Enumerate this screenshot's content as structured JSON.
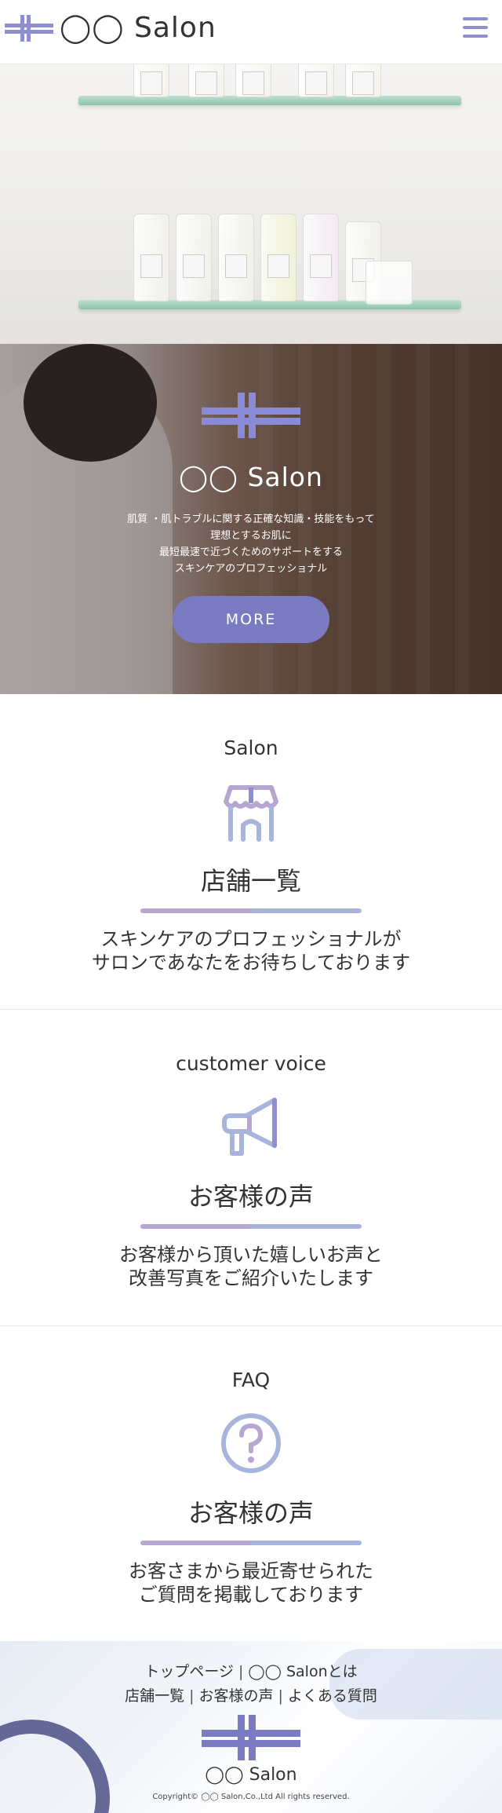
{
  "header": {
    "logo_text": "◯◯ Salon",
    "menu_icon": "hamburger-menu-icon"
  },
  "hero": {
    "title": "◯◯ Salon",
    "description": [
      "肌質 ・肌トラブルに関する正確な知識・技能をもって",
      "理想とするお肌に",
      "最短最速で近づくためのサポートをする",
      "スキンケアのプロフェッショナル"
    ],
    "more_button": "MORE"
  },
  "sections": [
    {
      "en": "Salon",
      "icon": "storefront-icon",
      "jp": "店舗一覧",
      "desc": [
        "スキンケアのプロフェッショナルが",
        "サロンであなたをお待ちしております"
      ]
    },
    {
      "en": "customer voice",
      "icon": "megaphone-icon",
      "jp": "お客様の声",
      "desc": [
        "お客様から頂いた嬉しいお声と",
        "改善写真をご紹介いたします"
      ]
    },
    {
      "en": "FAQ",
      "icon": "question-mark-icon",
      "jp": "お客様の声",
      "desc": [
        "お客さまから最近寄せられた",
        "ご質問を掲載しております"
      ]
    }
  ],
  "footer": {
    "nav_row1": [
      "トップページ",
      "◯◯ Salonとは"
    ],
    "nav_row2": [
      "店舗一覧",
      "お客様の声",
      "よくある質問"
    ],
    "separator": "|",
    "logo_text": "◯◯ Salon",
    "copyright": "Copyright© ◯◯ Salon,Co.,Ltd All rights reserved."
  },
  "colors": {
    "accent": "#7b7bc4",
    "logo": "#8f8fd0",
    "bar_left": "#b7a6cf",
    "bar_right": "#a9b4dc"
  }
}
